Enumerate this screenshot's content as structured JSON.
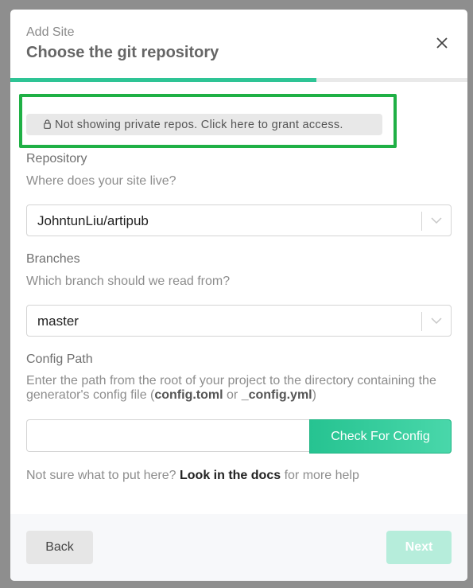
{
  "header": {
    "subtitle": "Add Site",
    "title": "Choose the git repository",
    "close_icon": "close-icon"
  },
  "progress": {
    "fraction": 0.67,
    "color": "#2ec495"
  },
  "private_repos": {
    "icon": "lock-icon",
    "label": "Not showing private repos. Click here to grant access."
  },
  "repository": {
    "label": "Repository",
    "hint": "Where does your site live?",
    "value": "JohntunLiu/artipub"
  },
  "branches": {
    "label": "Branches",
    "hint": "Which branch should we read from?",
    "value": "master"
  },
  "config": {
    "label": "Config Path",
    "hint_prefix": "Enter the path from the root of your project to the directory containing the generator's config file (",
    "hint_file1": "config.toml",
    "hint_or": " or ",
    "hint_file2": "_config.yml",
    "hint_suffix": ")",
    "input_value": "",
    "button_label": "Check For Config"
  },
  "docs": {
    "prefix": "Not sure what to put here? ",
    "link": "Look in the docs",
    "suffix": " for more help"
  },
  "footer": {
    "back_label": "Back",
    "next_label": "Next"
  },
  "colors": {
    "accent": "#2ec495",
    "highlight_border": "#1fb045",
    "next_disabled": "#b6eddb"
  }
}
